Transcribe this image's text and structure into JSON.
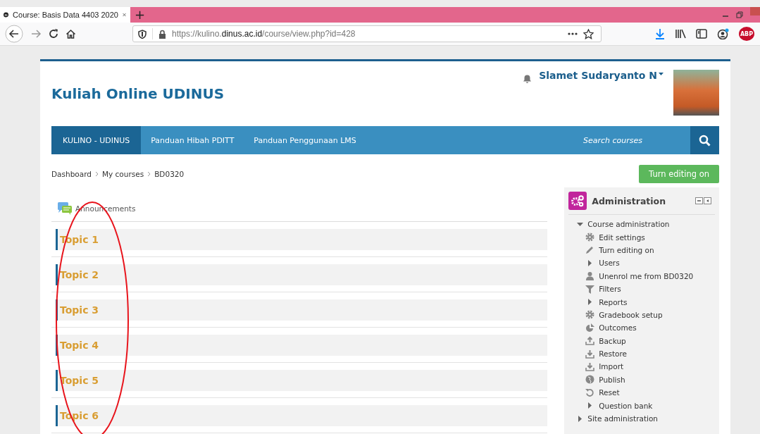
{
  "browser": {
    "tab_title": "Course: Basis Data 4403 2020",
    "url_prefix": "https://kulino.",
    "url_domain": "dinus.ac.id",
    "url_path": "/course/view.php?id=428",
    "new_tab": "+",
    "adblock_badge": "ABP"
  },
  "site": {
    "title": "Kuliah Online UDINUS",
    "user_name": "Slamet Sudaryanto N"
  },
  "nav": {
    "items": [
      {
        "label": "KULINO - UDINUS",
        "selected": true
      },
      {
        "label": "Panduan Hibah PDITT",
        "selected": false
      },
      {
        "label": "Panduan Penggunaan LMS",
        "selected": false
      }
    ],
    "search": {
      "placeholder": "Search courses"
    }
  },
  "breadcrumb": [
    "Dashboard",
    "My courses",
    "BD0320"
  ],
  "edit_button": "Turn editing on",
  "announcements": "Announcements",
  "topics": [
    "Topic 1",
    "Topic 2",
    "Topic 3",
    "Topic 4",
    "Topic 5",
    "Topic 6"
  ],
  "admin": {
    "title": "Administration",
    "tree": [
      {
        "label": "Course administration",
        "kind": "branch",
        "expanded": true,
        "children": [
          {
            "label": "Edit settings",
            "kind": "settings"
          },
          {
            "label": "Turn editing on",
            "kind": "edit"
          },
          {
            "label": "Users",
            "kind": "branch",
            "expanded": false
          },
          {
            "label": "Unenrol me from BD0320",
            "kind": "user"
          },
          {
            "label": "Filters",
            "kind": "filter"
          },
          {
            "label": "Reports",
            "kind": "branch",
            "expanded": false
          },
          {
            "label": "Gradebook setup",
            "kind": "settings"
          },
          {
            "label": "Outcomes",
            "kind": "outcomes"
          },
          {
            "label": "Backup",
            "kind": "upload"
          },
          {
            "label": "Restore",
            "kind": "download"
          },
          {
            "label": "Import",
            "kind": "download"
          },
          {
            "label": "Publish",
            "kind": "globe"
          },
          {
            "label": "Reset",
            "kind": "reset"
          },
          {
            "label": "Question bank",
            "kind": "branch",
            "expanded": false
          }
        ]
      },
      {
        "label": "Site administration",
        "kind": "branch",
        "expanded": false
      }
    ]
  }
}
